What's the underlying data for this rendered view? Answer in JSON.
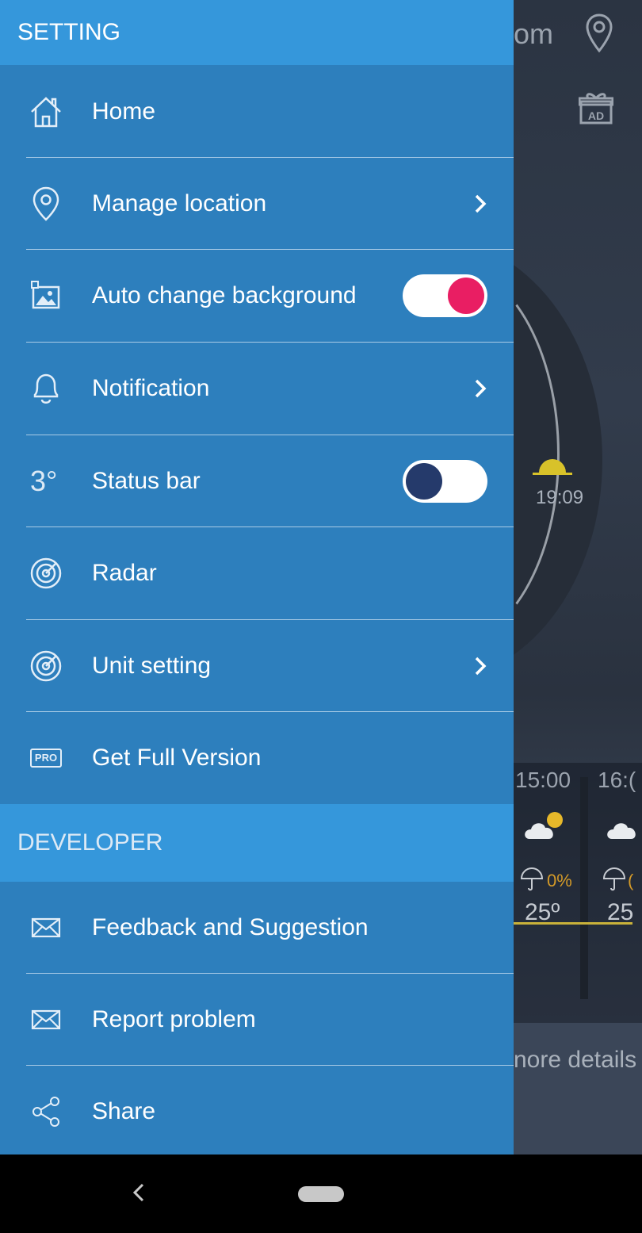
{
  "background_app": {
    "title_fragment": "om",
    "sunset_time": "19:09",
    "hours": [
      "15:00",
      "16:("
    ],
    "precip": [
      "0%",
      "("
    ],
    "temps": [
      "25º",
      "25"
    ],
    "more_details": "nore details"
  },
  "drawer": {
    "setting_header": "SETTING",
    "items": [
      {
        "label": "Home",
        "icon": "home-icon"
      },
      {
        "label": "Manage location",
        "icon": "location-pin-icon",
        "chevron": true
      },
      {
        "label": "Auto change background",
        "icon": "image-icon",
        "toggle": "on"
      },
      {
        "label": "Notification",
        "icon": "bell-icon",
        "chevron": true
      },
      {
        "label": "Status bar",
        "icon": "temperature-icon",
        "icon_text": "3°",
        "toggle": "off"
      },
      {
        "label": "Radar",
        "icon": "radar-icon"
      },
      {
        "label": "Unit setting",
        "icon": "radar-icon",
        "chevron": true
      },
      {
        "label": "Get Full Version",
        "icon": "pro-badge-icon",
        "icon_text": "PRO"
      }
    ],
    "developer_header": "DEVELOPER",
    "developer_items": [
      {
        "label": "Feedback and Suggestion",
        "icon": "mail-icon"
      },
      {
        "label": "Report problem",
        "icon": "mail-icon"
      },
      {
        "label": "Share",
        "icon": "share-icon"
      }
    ]
  },
  "colors": {
    "drawer_bg": "#2d7fbd",
    "header_bg": "#3597db",
    "toggle_on": "#e91e63",
    "toggle_off": "#253a6b"
  }
}
